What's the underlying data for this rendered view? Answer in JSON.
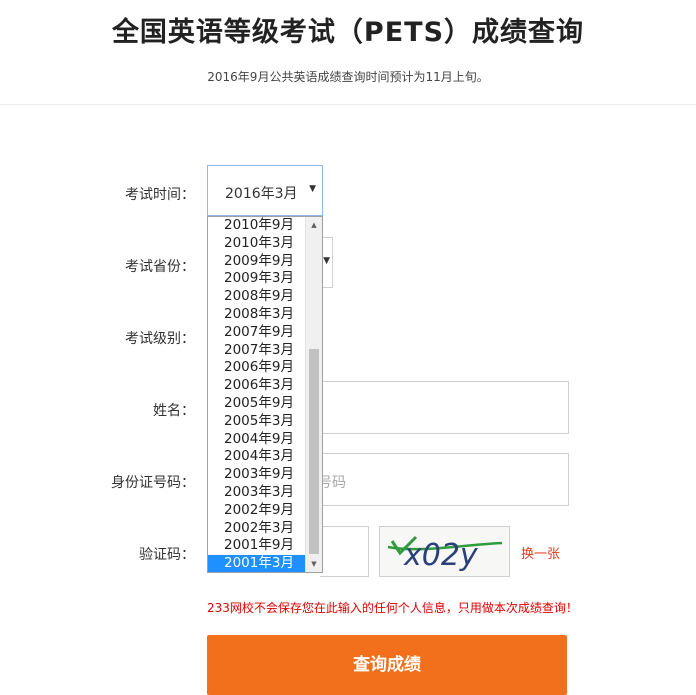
{
  "page": {
    "title": "全国英语等级考试（PETS）成绩查询",
    "notice": "2016年9月公共英语成绩查询时间预计为11月上旬。"
  },
  "form": {
    "exam_time": {
      "label": "考试时间：",
      "selected": "2016年3月",
      "options": [
        "2010年9月",
        "2010年3月",
        "2009年9月",
        "2009年3月",
        "2008年9月",
        "2008年3月",
        "2007年9月",
        "2007年3月",
        "2006年9月",
        "2006年3月",
        "2005年9月",
        "2005年3月",
        "2004年9月",
        "2004年3月",
        "2003年9月",
        "2003年3月",
        "2002年9月",
        "2002年3月",
        "2001年9月",
        "2001年3月"
      ],
      "highlighted": "2001年3月"
    },
    "exam_province": {
      "label": "考试省份："
    },
    "exam_level": {
      "label": "考试级别："
    },
    "name": {
      "label": "姓名："
    },
    "id_number": {
      "label": "身份证号码：",
      "placeholder_visible": "号码"
    },
    "captcha": {
      "label": "验证码：",
      "image_text": "x02y",
      "refresh_label": "换一张"
    },
    "privacy_notice": "233网校不会保存您在此输入的任何个人信息，只用做本次成绩查询！",
    "submit_label": "查询成绩"
  },
  "colors": {
    "accent": "#f26f1b",
    "warning_text": "#e00000",
    "dropdown_highlight": "#1e90ff"
  }
}
